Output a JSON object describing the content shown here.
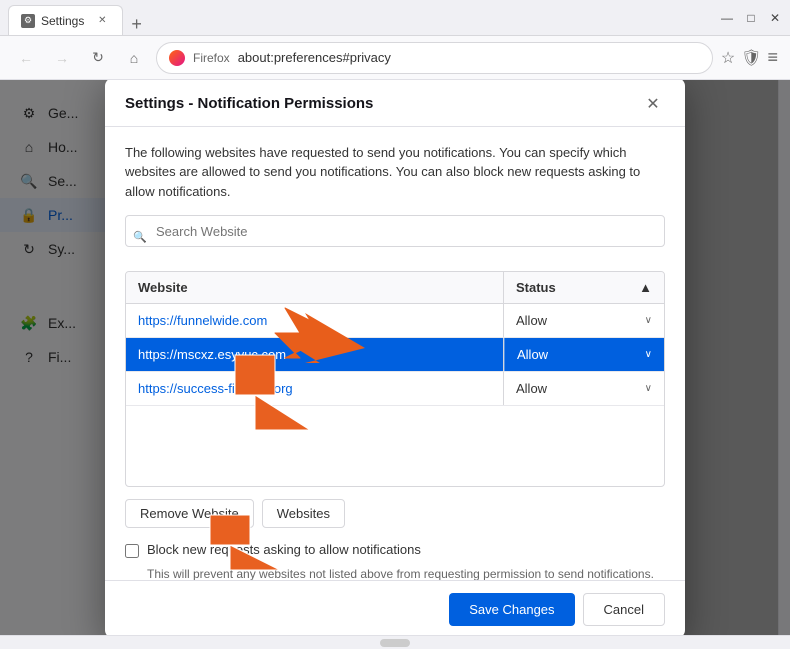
{
  "browser": {
    "tab_title": "Settings",
    "tab_favicon": "⚙",
    "new_tab_icon": "+",
    "url": "about:preferences#privacy",
    "browser_name": "Firefox"
  },
  "nav": {
    "back_icon": "←",
    "forward_icon": "→",
    "reload_icon": "↻",
    "home_icon": "⌂",
    "bookmark_icon": "☆",
    "shield_icon": "🛡",
    "menu_icon": "≡"
  },
  "window_controls": {
    "minimize": "—",
    "maximize": "□",
    "close": "✕"
  },
  "sidebar": {
    "items": [
      {
        "id": "general",
        "label": "Ge...",
        "icon": "⚙"
      },
      {
        "id": "home",
        "label": "Ho...",
        "icon": "⌂"
      },
      {
        "id": "search",
        "label": "Se...",
        "icon": "🔍"
      },
      {
        "id": "privacy",
        "label": "Pr...",
        "icon": "🔒",
        "active": true
      },
      {
        "id": "sync",
        "label": "Sy...",
        "icon": "↻"
      },
      {
        "id": "extensions",
        "label": "Ex...",
        "icon": "🧩"
      },
      {
        "id": "firefox",
        "label": "Fi...",
        "icon": "?"
      }
    ]
  },
  "dialog": {
    "title": "Settings - Notification Permissions",
    "close_icon": "✕",
    "description": "The following websites have requested to send you notifications. You can specify which websites are allowed to send you notifications. You can also block new requests asking to allow notifications.",
    "search_placeholder": "Search Website",
    "table": {
      "col_website": "Website",
      "col_status": "Status",
      "sort_icon": "▲",
      "rows": [
        {
          "url": "https://funnelwide.com",
          "status": "Allow",
          "selected": false
        },
        {
          "url": "https://mscxz.esyvuc.com",
          "status": "Allow",
          "selected": true
        },
        {
          "url": "https://success-finance.org",
          "status": "Allow",
          "selected": false
        }
      ],
      "chevron": "∨"
    },
    "buttons": {
      "remove_website": "Remove Website",
      "all_websites": "Websites"
    },
    "checkbox": {
      "label": "Block new requests asking to allow notifications",
      "description": "This will prevent any websites not listed above from requesting permission to send notifications. Blocking notifications may break some website features.",
      "checked": false
    },
    "footer": {
      "save_label": "Save Changes",
      "cancel_label": "Cancel"
    }
  }
}
